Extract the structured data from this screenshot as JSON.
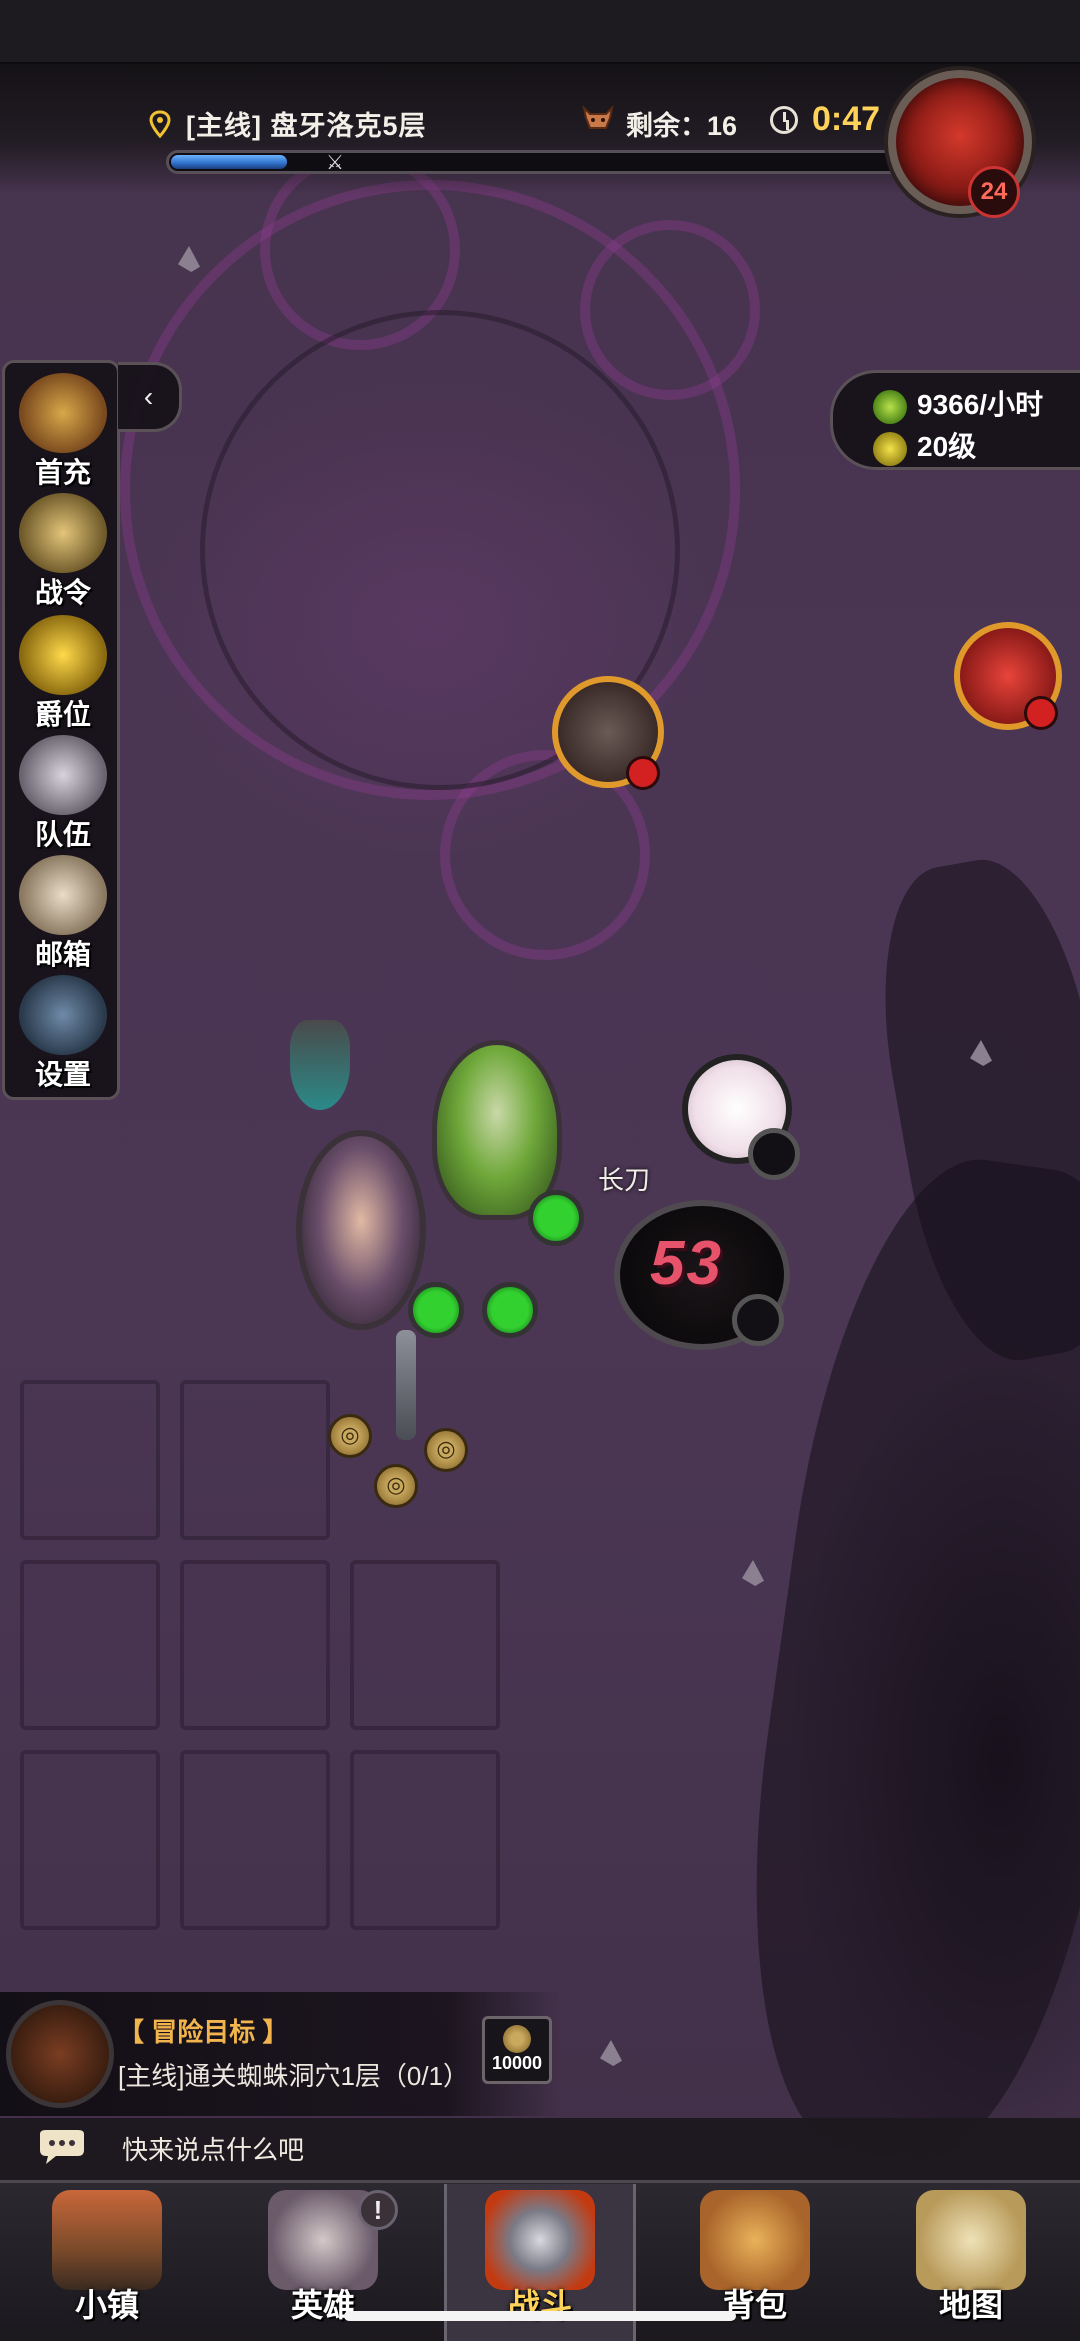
{
  "header": {
    "quest_title": "[主线] 盘牙洛克5层",
    "remaining": "剩余：16",
    "timer": "0:47",
    "wave_progress": 0.16,
    "boss_level": "24"
  },
  "left_menu": {
    "items": [
      {
        "label": "首充",
        "icon": "treasure-chest-icon"
      },
      {
        "label": "战令",
        "icon": "battle-pass-icon"
      },
      {
        "label": "爵位",
        "icon": "crown-icon"
      },
      {
        "label": "队伍",
        "icon": "team-icon"
      },
      {
        "label": "邮箱",
        "icon": "mail-icon"
      },
      {
        "label": "设置",
        "icon": "gear-icon"
      }
    ],
    "collapse_glyph": "‹"
  },
  "resources": {
    "rate": "9366/小时",
    "level": "20级"
  },
  "battle": {
    "weapon_label": "长刀",
    "damage": "53"
  },
  "goal": {
    "title": "【 冒险目标 】",
    "description": "[主线]通关蜘蛛洞穴1层（0/1）",
    "reward": "10000"
  },
  "chat": {
    "placeholder": "快来说点什么吧"
  },
  "nav": {
    "items": [
      {
        "label": "小镇",
        "icon": "town-icon"
      },
      {
        "label": "英雄",
        "icon": "hero-icon"
      },
      {
        "label": "战斗",
        "icon": "crossed-swords-icon"
      },
      {
        "label": "背包",
        "icon": "backpack-icon"
      },
      {
        "label": "地图",
        "icon": "map-scroll-icon"
      }
    ],
    "active": "战斗",
    "hero_alert": "!"
  },
  "colors": {
    "accent_gold": "#ffd35a",
    "goal_title": "#f2b44c",
    "damage": "#e8536c",
    "progress": "#2f6fc8",
    "enemy_badge": "#d32020",
    "slot_green": "#33d130"
  }
}
